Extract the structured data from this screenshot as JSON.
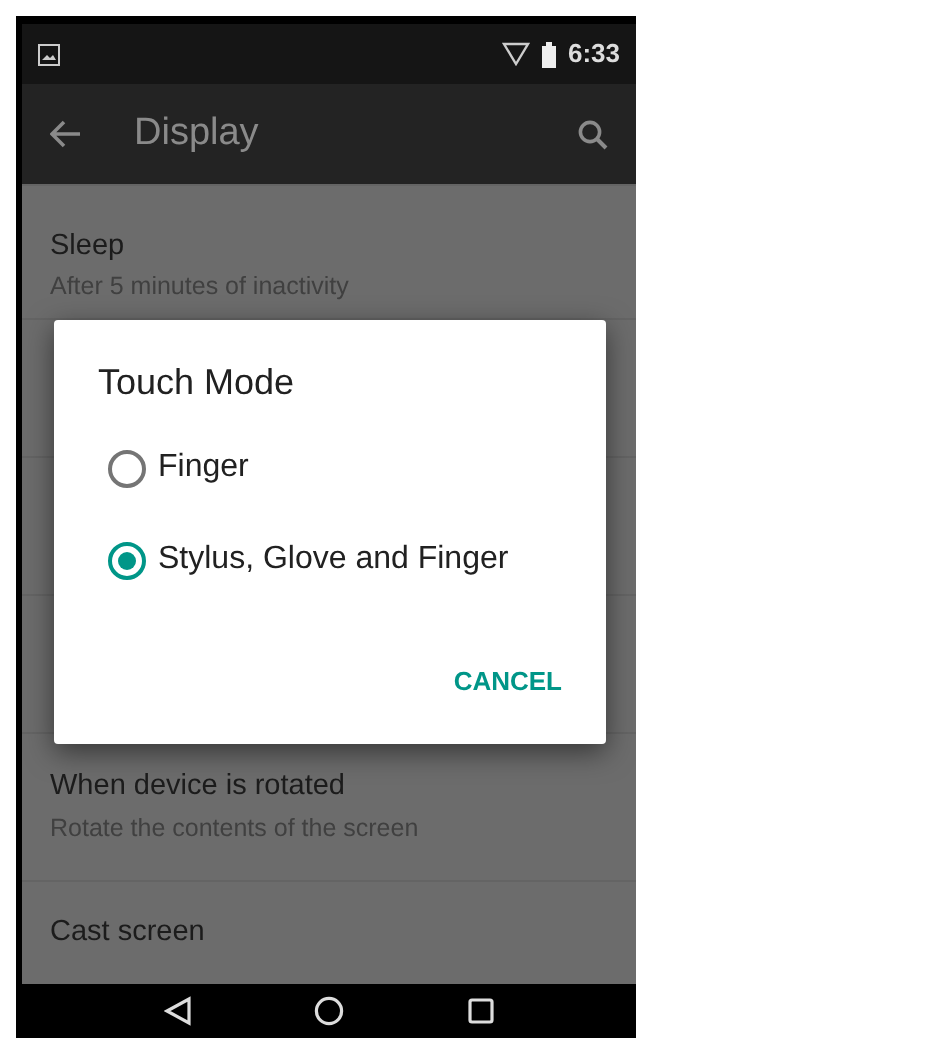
{
  "status_bar": {
    "time": "6:33"
  },
  "toolbar": {
    "title": "Display"
  },
  "settings": [
    {
      "title": "Sleep",
      "summary": "After 5 minutes of inactivity"
    },
    {
      "title": "When device is rotated",
      "summary": "Rotate the contents of the screen"
    },
    {
      "title": "Cast screen"
    }
  ],
  "dialog": {
    "title": "Touch Mode",
    "options": [
      {
        "label": "Finger",
        "selected": false
      },
      {
        "label": "Stylus, Glove and Finger",
        "selected": true
      }
    ],
    "buttons": [
      "CANCEL"
    ]
  }
}
